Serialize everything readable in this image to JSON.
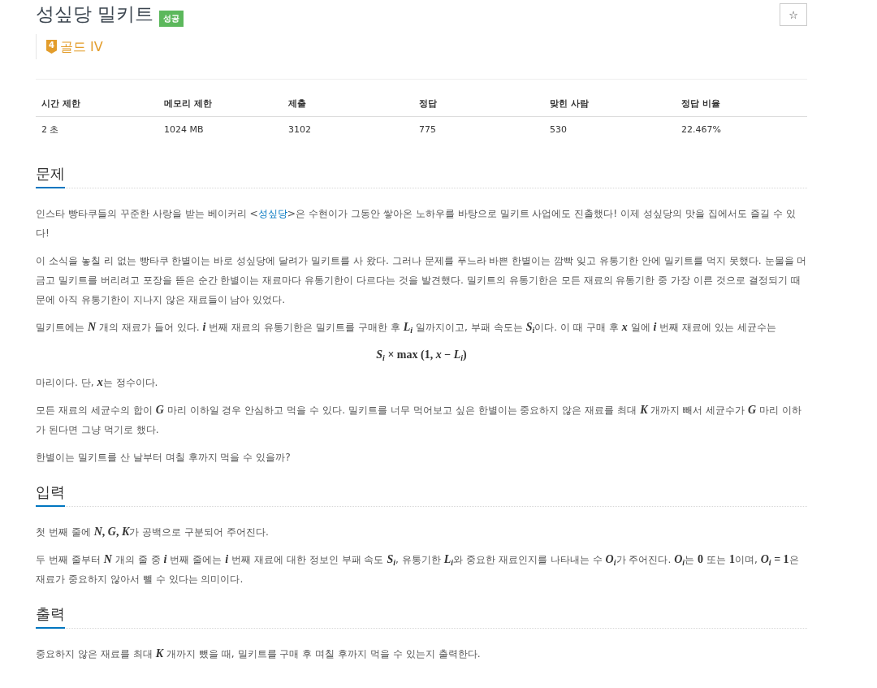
{
  "header": {
    "title": "성싶당 밀키트",
    "result": {
      "text": "성공",
      "kind": "success"
    },
    "favorite_button": "☆"
  },
  "tier": {
    "badge": "4",
    "label": "골드 IV",
    "kind": "gold"
  },
  "stats": {
    "columns": [
      "시간 제한",
      "메모리 제한",
      "제출",
      "정답",
      "맞힌 사람",
      "정답 비율"
    ],
    "rows": [
      [
        "2 초",
        "1024 MB",
        "3102",
        "775",
        "530",
        "22.467%"
      ]
    ]
  },
  "sections": [
    {
      "heading": "문제",
      "blocks": [
        {
          "kind": "paragraph",
          "parts": [
            {
              "kind": "text",
              "text": "인스타 빵타쿠들의 꾸준한 사랑을 받는 베이커리 <"
            },
            {
              "kind": "link",
              "text": "성싶당"
            },
            {
              "kind": "text",
              "text": ">은 수현이가 그동안 쌓아온 노하우를 바탕으로 밀키트 사업에도 진출했다! 이제 성싶당의 맛을 집에서도 즐길 수 있다!"
            }
          ]
        },
        {
          "kind": "paragraph",
          "parts": [
            {
              "kind": "text",
              "text": "이 소식을 놓칠 리 없는 빵타쿠 한별이는 바로 성싶당에 달려가 밀키트를 사 왔다. 그러나 문제를 푸느라 바쁜 한별이는 깜빡 잊고 유통기한 안에 밀키트를 먹지 못했다. 눈물을 머금고 밀키트를 버리려고 포장을 뜯은 순간 한별이는 재료마다 유통기한이 다르다는 것을 발견했다. 밀키트의 유통기한은 모든 재료의 유통기한 중 가장 이른 것으로 결정되기 때문에 아직 유통기한이 지나지 않은 재료들이 남아 있었다."
            }
          ]
        },
        {
          "kind": "paragraph",
          "parts": [
            {
              "kind": "text",
              "text": "밀키트에는 "
            },
            {
              "kind": "math",
              "text": "*N*"
            },
            {
              "kind": "text",
              "text": " 개의 재료가 들어 있다. "
            },
            {
              "kind": "math",
              "text": "*i*"
            },
            {
              "kind": "text",
              "text": " 번째 재료의 유통기한은 밀키트를 구매한 후 "
            },
            {
              "kind": "math",
              "text": "*L*$_{i}$"
            },
            {
              "kind": "text",
              "text": " 일까지이고, 부패 속도는 "
            },
            {
              "kind": "math",
              "text": "*S*$_{i}$"
            },
            {
              "kind": "text",
              "text": "이다. 이 때 구매 후 "
            },
            {
              "kind": "math",
              "text": "*x*"
            },
            {
              "kind": "text",
              "text": " 일에 "
            },
            {
              "kind": "math",
              "text": "*i*"
            },
            {
              "kind": "text",
              "text": " 번째 재료에 있는 세균수는"
            }
          ]
        },
        {
          "kind": "formula",
          "text": "*S*$_{i}$ × **max** (**1**, *x* − *L*$_{i}$)"
        },
        {
          "kind": "paragraph",
          "parts": [
            {
              "kind": "text",
              "text": "마리이다. 단, "
            },
            {
              "kind": "math",
              "text": "*x*"
            },
            {
              "kind": "text",
              "text": "는 정수이다."
            }
          ]
        },
        {
          "kind": "paragraph",
          "parts": [
            {
              "kind": "text",
              "text": "모든 재료의 세균수의 합이 "
            },
            {
              "kind": "math",
              "text": "*G*"
            },
            {
              "kind": "text",
              "text": " 마리 이하일 경우 안심하고 먹을 수 있다. 밀키트를 너무 먹어보고 싶은 한별이는 중요하지 않은 재료를 최대 "
            },
            {
              "kind": "math",
              "text": "*K*"
            },
            {
              "kind": "text",
              "text": " 개까지 빼서 세균수가 "
            },
            {
              "kind": "math",
              "text": "*G*"
            },
            {
              "kind": "text",
              "text": " 마리 이하가 된다면 그냥 먹기로 했다."
            }
          ]
        },
        {
          "kind": "paragraph",
          "parts": [
            {
              "kind": "text",
              "text": "한별이는 밀키트를 산 날부터 며칠 후까지 먹을 수 있을까?"
            }
          ]
        }
      ]
    },
    {
      "heading": "입력",
      "blocks": [
        {
          "kind": "paragraph",
          "parts": [
            {
              "kind": "text",
              "text": "첫 번째 줄에 "
            },
            {
              "kind": "math",
              "text": "*N*, *G*, *K*"
            },
            {
              "kind": "text",
              "text": "가 공백으로 구분되어 주어진다."
            }
          ]
        },
        {
          "kind": "paragraph",
          "parts": [
            {
              "kind": "text",
              "text": "두 번째 줄부터 "
            },
            {
              "kind": "math",
              "text": "*N*"
            },
            {
              "kind": "text",
              "text": " 개의 줄 중 "
            },
            {
              "kind": "math",
              "text": "*i*"
            },
            {
              "kind": "text",
              "text": " 번째 줄에는 "
            },
            {
              "kind": "math",
              "text": "*i*"
            },
            {
              "kind": "text",
              "text": " 번째 재료에 대한 정보인 부패 속도 "
            },
            {
              "kind": "math",
              "text": "*S*$_{i}$"
            },
            {
              "kind": "text",
              "text": ", 유통기한 "
            },
            {
              "kind": "math",
              "text": "*L*$_{i}$"
            },
            {
              "kind": "text",
              "text": "와 중요한 재료인지를 나타내는 수 "
            },
            {
              "kind": "math",
              "text": "*O*$_{i}$"
            },
            {
              "kind": "text",
              "text": "가 주어진다. "
            },
            {
              "kind": "math",
              "text": "*O*$_{i}$"
            },
            {
              "kind": "text",
              "text": "는 "
            },
            {
              "kind": "math",
              "text": "**0**"
            },
            {
              "kind": "text",
              "text": " 또는 "
            },
            {
              "kind": "math",
              "text": "**1**"
            },
            {
              "kind": "text",
              "text": "이며, "
            },
            {
              "kind": "math",
              "text": "*O*$_{i}$ = **1**"
            },
            {
              "kind": "text",
              "text": "은 재료가 중요하지 않아서 뺄 수 있다는 의미이다."
            }
          ]
        }
      ]
    },
    {
      "heading": "출력",
      "blocks": [
        {
          "kind": "paragraph",
          "parts": [
            {
              "kind": "text",
              "text": "중요하지 않은 재료를 최대 "
            },
            {
              "kind": "math",
              "text": "*K*"
            },
            {
              "kind": "text",
              "text": " 개까지 뺐을 때, 밀키트를 구매 후 며칠 후까지 먹을 수 있는지 출력한다."
            }
          ]
        }
      ]
    }
  ]
}
